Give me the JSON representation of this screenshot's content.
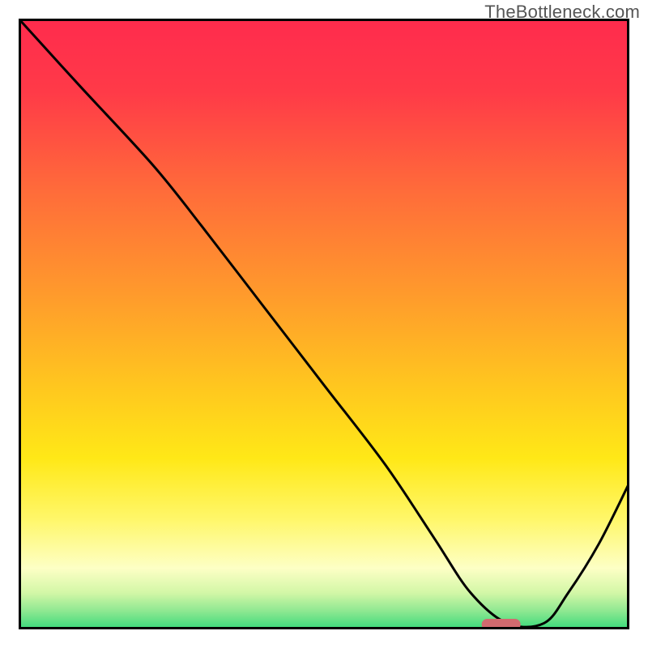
{
  "watermark": "TheBottleneck.com",
  "chart_data": {
    "type": "line",
    "title": "",
    "xlabel": "",
    "ylabel": "",
    "xlim": [
      0,
      100
    ],
    "ylim": [
      0,
      100
    ],
    "series": [
      {
        "name": "curve",
        "type": "line",
        "x": [
          0,
          10,
          22,
          30,
          40,
          50,
          60,
          68,
          74,
          80,
          86,
          90,
          95,
          100
        ],
        "y": [
          100,
          89,
          76,
          66,
          53,
          40,
          27,
          15,
          6,
          1,
          1,
          6,
          14,
          24
        ]
      }
    ],
    "marker": {
      "name": "optimal-marker",
      "x": 79,
      "y": 0.8,
      "color": "#d16a6f"
    },
    "gradient_stops": [
      {
        "pct": 0,
        "color": "#ff2b4d"
      },
      {
        "pct": 12,
        "color": "#ff3a48"
      },
      {
        "pct": 28,
        "color": "#ff6b3a"
      },
      {
        "pct": 45,
        "color": "#ff9a2c"
      },
      {
        "pct": 60,
        "color": "#ffc61f"
      },
      {
        "pct": 72,
        "color": "#ffe817"
      },
      {
        "pct": 82,
        "color": "#fff76a"
      },
      {
        "pct": 90,
        "color": "#fdffc5"
      },
      {
        "pct": 94,
        "color": "#d3f7a7"
      },
      {
        "pct": 97,
        "color": "#8ee891"
      },
      {
        "pct": 100,
        "color": "#38d97b"
      }
    ],
    "border_color": "#000000"
  }
}
